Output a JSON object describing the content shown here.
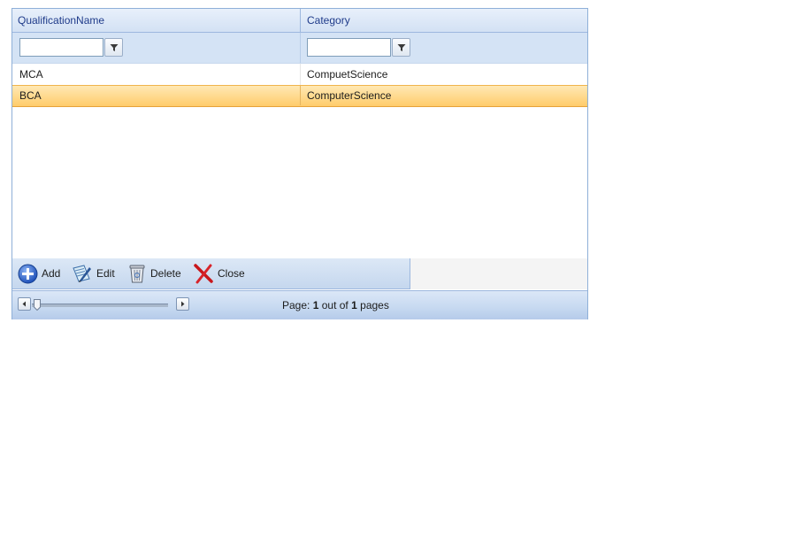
{
  "grid": {
    "columns": [
      "QualificationName",
      "Category"
    ],
    "filters": [
      {
        "value": ""
      },
      {
        "value": ""
      }
    ],
    "rows": [
      {
        "qualification": "MCA",
        "category": "CompuetScience",
        "selected": false
      },
      {
        "qualification": "BCA",
        "category": "ComputerScience",
        "selected": true
      }
    ]
  },
  "commands": {
    "add": "Add",
    "edit": "Edit",
    "delete": "Delete",
    "close": "Close"
  },
  "pager": {
    "prefix": "Page:",
    "current": "1",
    "middle": "out of",
    "total": "1",
    "suffix": "pages"
  },
  "colors": {
    "header_text": "#1f3b8a",
    "selected_row": "#ffcc6b",
    "border": "#8fb0d8"
  }
}
